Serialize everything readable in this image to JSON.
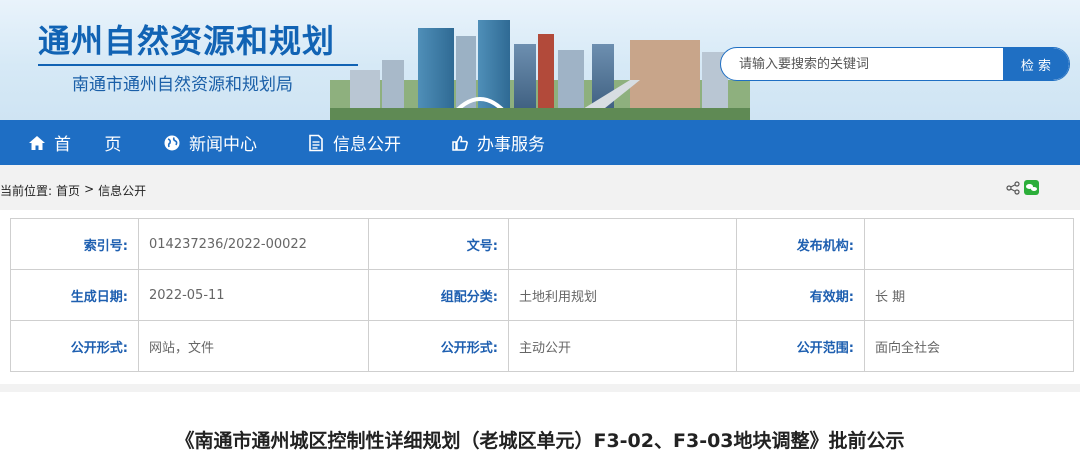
{
  "header": {
    "title": "通州自然资源和规划",
    "subtitle": "南通市通州自然资源和规划局",
    "search": {
      "placeholder": "请输入要搜索的关键词",
      "button_label": "检 索"
    }
  },
  "nav": {
    "items": [
      {
        "label": "首 页",
        "icon": "home-icon"
      },
      {
        "label": "新闻中心",
        "icon": "globe-icon"
      },
      {
        "label": "信息公开",
        "icon": "document-icon"
      },
      {
        "label": "办事服务",
        "icon": "thumbs-up-icon"
      }
    ],
    "color": "#1e6ec4"
  },
  "breadcrumb": {
    "prefix": "当前位置:",
    "home": "首页",
    "separator": ">",
    "current": "信息公开"
  },
  "meta": {
    "rows": [
      [
        {
          "key": "索引号:",
          "value": "014237236/2022-00022"
        },
        {
          "key": "文号:",
          "value": ""
        },
        {
          "key": "发布机构:",
          "value": ""
        }
      ],
      [
        {
          "key": "生成日期:",
          "value": "2022-05-11"
        },
        {
          "key": "组配分类:",
          "value": "土地利用规划"
        },
        {
          "key": "有效期:",
          "value": "长 期"
        }
      ],
      [
        {
          "key": "公开形式:",
          "value": "网站，文件"
        },
        {
          "key": "公开形式:",
          "value": "主动公开"
        },
        {
          "key": "公开范围:",
          "value": "面向全社会"
        }
      ]
    ]
  },
  "article": {
    "title": "《南通市通州城区控制性详细规划（老城区单元）F3-02、F3-03地块调整》批前公示"
  }
}
